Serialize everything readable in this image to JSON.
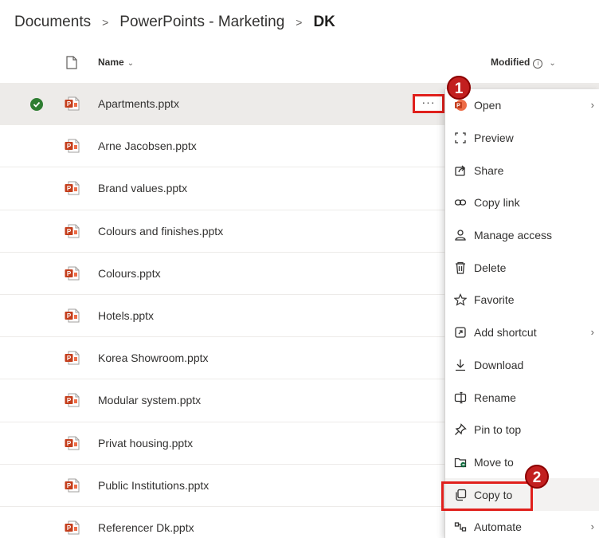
{
  "breadcrumb": {
    "items": [
      "Documents",
      "PowerPoints - Marketing"
    ],
    "separator": ">",
    "current": "DK"
  },
  "header": {
    "name_label": "Name",
    "modified_label": "Modified",
    "sort_chevron": "⌄",
    "info_glyph": "i"
  },
  "files": [
    {
      "name": "Apartments.pptx",
      "selected": true
    },
    {
      "name": "Arne Jacobsen.pptx"
    },
    {
      "name": "Brand values.pptx"
    },
    {
      "name": "Colours and finishes.pptx"
    },
    {
      "name": "Colours.pptx"
    },
    {
      "name": "Hotels.pptx"
    },
    {
      "name": "Korea Showroom.pptx"
    },
    {
      "name": "Modular system.pptx"
    },
    {
      "name": "Privat housing.pptx"
    },
    {
      "name": "Public Institutions.pptx"
    },
    {
      "name": "Referencer Dk.pptx"
    }
  ],
  "more_button": "···",
  "context_menu": {
    "items": [
      {
        "label": "Open",
        "icon": "powerpoint-icon",
        "submenu": true
      },
      {
        "label": "Preview",
        "icon": "preview-icon"
      },
      {
        "label": "Share",
        "icon": "share-icon"
      },
      {
        "label": "Copy link",
        "icon": "link-icon"
      },
      {
        "label": "Manage access",
        "icon": "people-icon"
      },
      {
        "label": "Delete",
        "icon": "trash-icon"
      },
      {
        "label": "Favorite",
        "icon": "star-icon"
      },
      {
        "label": "Add shortcut",
        "icon": "shortcut-icon",
        "submenu": true
      },
      {
        "label": "Download",
        "icon": "download-icon"
      },
      {
        "label": "Rename",
        "icon": "rename-icon"
      },
      {
        "label": "Pin to top",
        "icon": "pin-icon"
      },
      {
        "label": "Move to",
        "icon": "move-icon"
      },
      {
        "label": "Copy to",
        "icon": "copy-icon",
        "highlighted": true
      },
      {
        "label": "Automate",
        "icon": "automate-icon",
        "submenu": true
      }
    ],
    "submenu_arrow": "›"
  },
  "callouts": {
    "step1": "1",
    "step2": "2"
  },
  "colors": {
    "accent_red": "#e0201c",
    "badge_red": "#c21f1f",
    "check_green": "#2e7d32",
    "ppt_orange": "#c43e1c"
  }
}
